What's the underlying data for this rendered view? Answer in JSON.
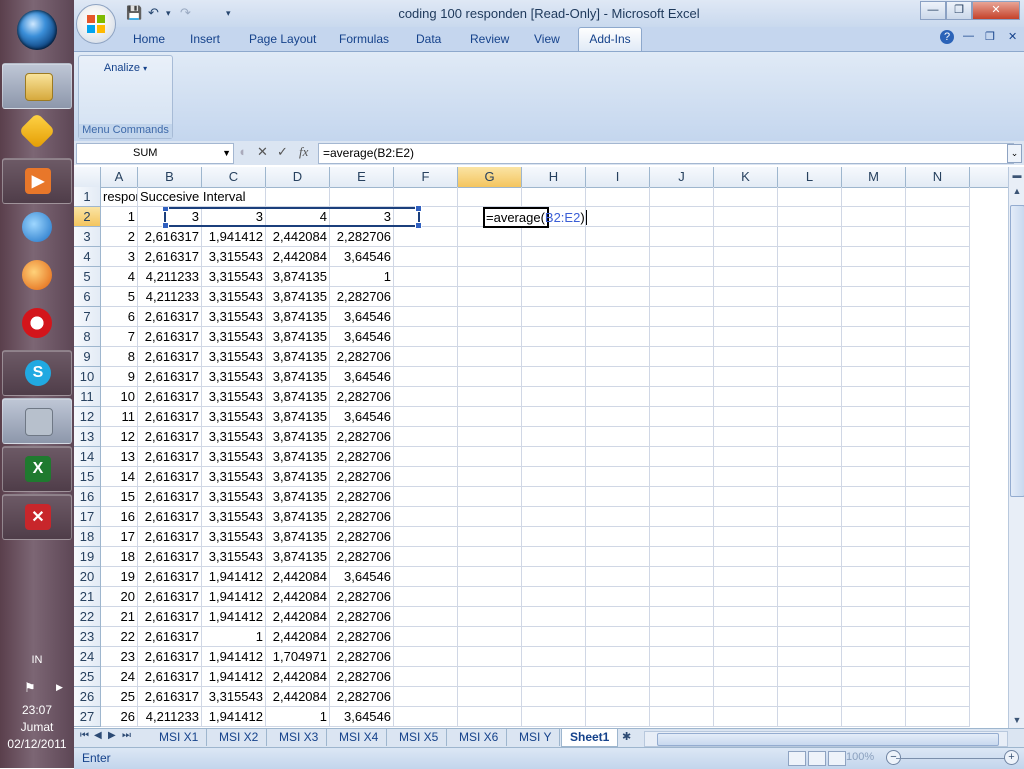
{
  "window": {
    "title": "coding 100 responden  [Read-Only] - Microsoft Excel"
  },
  "ribbon": {
    "tabs": [
      "Home",
      "Insert",
      "Page Layout",
      "Formulas",
      "Data",
      "Review",
      "View",
      "Add-Ins"
    ],
    "active_tab": "Add-Ins",
    "group": {
      "button_label": "Analize",
      "label": "Menu Commands"
    }
  },
  "formula_bar": {
    "name_box": "SUM",
    "formula": "=average(B2:E2)"
  },
  "grid": {
    "columns": [
      "A",
      "B",
      "C",
      "D",
      "E",
      "F",
      "G",
      "H",
      "I",
      "J",
      "K",
      "L",
      "M",
      "N"
    ],
    "row_headers": [
      "1",
      "2",
      "3",
      "4",
      "5",
      "6",
      "7",
      "8",
      "9",
      "10",
      "11",
      "12",
      "13",
      "14",
      "15",
      "16",
      "17",
      "18",
      "19",
      "20",
      "21",
      "22",
      "23",
      "24",
      "25",
      "26",
      "27"
    ],
    "header_row": {
      "a1": "responde",
      "b1": "Succesive Interval"
    },
    "rows": [
      [
        "1",
        "3",
        "3",
        "4",
        "3"
      ],
      [
        "2",
        "2,616317",
        "1,941412",
        "2,442084",
        "2,282706"
      ],
      [
        "3",
        "2,616317",
        "3,315543",
        "2,442084",
        "3,64546"
      ],
      [
        "4",
        "4,211233",
        "3,315543",
        "3,874135",
        "1"
      ],
      [
        "5",
        "4,211233",
        "3,315543",
        "3,874135",
        "2,282706"
      ],
      [
        "6",
        "2,616317",
        "3,315543",
        "3,874135",
        "3,64546"
      ],
      [
        "7",
        "2,616317",
        "3,315543",
        "3,874135",
        "3,64546"
      ],
      [
        "8",
        "2,616317",
        "3,315543",
        "3,874135",
        "2,282706"
      ],
      [
        "9",
        "2,616317",
        "3,315543",
        "3,874135",
        "3,64546"
      ],
      [
        "10",
        "2,616317",
        "3,315543",
        "3,874135",
        "2,282706"
      ],
      [
        "11",
        "2,616317",
        "3,315543",
        "3,874135",
        "3,64546"
      ],
      [
        "12",
        "2,616317",
        "3,315543",
        "3,874135",
        "2,282706"
      ],
      [
        "13",
        "2,616317",
        "3,315543",
        "3,874135",
        "2,282706"
      ],
      [
        "14",
        "2,616317",
        "3,315543",
        "3,874135",
        "2,282706"
      ],
      [
        "15",
        "2,616317",
        "3,315543",
        "3,874135",
        "2,282706"
      ],
      [
        "16",
        "2,616317",
        "3,315543",
        "3,874135",
        "2,282706"
      ],
      [
        "17",
        "2,616317",
        "3,315543",
        "3,874135",
        "2,282706"
      ],
      [
        "18",
        "2,616317",
        "3,315543",
        "3,874135",
        "2,282706"
      ],
      [
        "19",
        "2,616317",
        "1,941412",
        "2,442084",
        "3,64546"
      ],
      [
        "20",
        "2,616317",
        "1,941412",
        "2,442084",
        "2,282706"
      ],
      [
        "21",
        "2,616317",
        "1,941412",
        "2,442084",
        "2,282706"
      ],
      [
        "22",
        "2,616317",
        "1",
        "2,442084",
        "2,282706"
      ],
      [
        "23",
        "2,616317",
        "1,941412",
        "1,704971",
        "2,282706"
      ],
      [
        "24",
        "2,616317",
        "1,941412",
        "2,442084",
        "2,282706"
      ],
      [
        "25",
        "2,616317",
        "3,315543",
        "2,442084",
        "2,282706"
      ],
      [
        "26",
        "4,211233",
        "1,941412",
        "1",
        "3,64546"
      ]
    ],
    "active_cell": {
      "prefix": "=average(",
      "ref": "B2:E2",
      "suffix": ")"
    }
  },
  "sheets": {
    "tabs": [
      "MSI X1",
      "MSI X2",
      "MSI X3",
      "MSI X4",
      "MSI X5",
      "MSI X6",
      "MSI Y",
      "Sheet1"
    ],
    "active": "Sheet1"
  },
  "status": {
    "mode": "Enter",
    "zoom": "100%"
  },
  "taskbar": {
    "language": "IN",
    "time": "23:07",
    "day": "Jumat",
    "date": "02/12/2011",
    "icons": [
      "start-orb-icon",
      "file-manager-icon",
      "winamp-icon",
      "media-player-icon",
      "internet-explorer-icon",
      "firefox-icon",
      "opera-icon",
      "skype-icon",
      "utility-icon",
      "excel-icon",
      "pdf-icon"
    ]
  },
  "colors": {
    "ribbon_bg": "#c4d6ee",
    "selected_header": "#f4c55f",
    "reference_blue": "#3b5ed6"
  }
}
